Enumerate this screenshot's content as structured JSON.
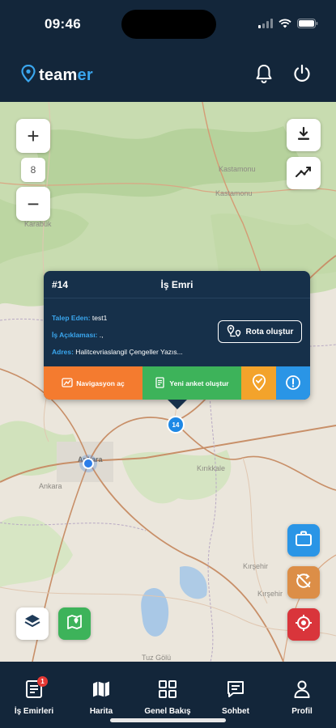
{
  "status_bar": {
    "time": "09:46"
  },
  "header": {
    "logo_text_main": "team",
    "logo_text_accent": "er",
    "icons": [
      "bell-icon",
      "power-icon"
    ]
  },
  "map": {
    "zoom_in_label": "+",
    "zoom_out_label": "−",
    "zoom_level": "8",
    "place_labels": [
      "Kastamonu",
      "Kastamonu",
      "Karabük",
      "Ankara",
      "Ankara",
      "Kırıkkale",
      "Kırşehir",
      "Kırşehir",
      "Tuz Gölü"
    ],
    "marker_label": "14"
  },
  "popup": {
    "id": "#14",
    "title": "İş Emri",
    "fields": [
      {
        "key": "Talep Eden:",
        "value": " test1"
      },
      {
        "key": "İş Açıklaması:",
        "value": " .,"
      },
      {
        "key": "Adres:",
        "value": " Halitcevriaslangil Çengeller Yazıs..."
      }
    ],
    "route_button": "Rota oluştur",
    "actions": [
      {
        "label": "Navigasyon aç",
        "color": "#f47b2f",
        "icon": "navigation-icon"
      },
      {
        "label": "Yeni anket oluştur",
        "color": "#3db35a",
        "icon": "survey-icon"
      },
      {
        "label": "",
        "color": "#f3a32b",
        "icon": "location-check-icon"
      },
      {
        "label": "",
        "color": "#2a95e6",
        "icon": "alert-icon"
      }
    ]
  },
  "fabs": {
    "briefcase_color": "#2a95e6",
    "rotate_color": "#dc8e47",
    "locate_color": "#d9353b",
    "route_color": "#3db35a"
  },
  "tabbar": {
    "tabs": [
      {
        "label": "İş Emirleri",
        "icon": "work-orders-icon",
        "badge": "1"
      },
      {
        "label": "Harita",
        "icon": "map-icon"
      },
      {
        "label": "Genel Bakış",
        "icon": "dashboard-icon"
      },
      {
        "label": "Sohbet",
        "icon": "chat-icon"
      },
      {
        "label": "Profil",
        "icon": "profile-icon"
      }
    ]
  }
}
